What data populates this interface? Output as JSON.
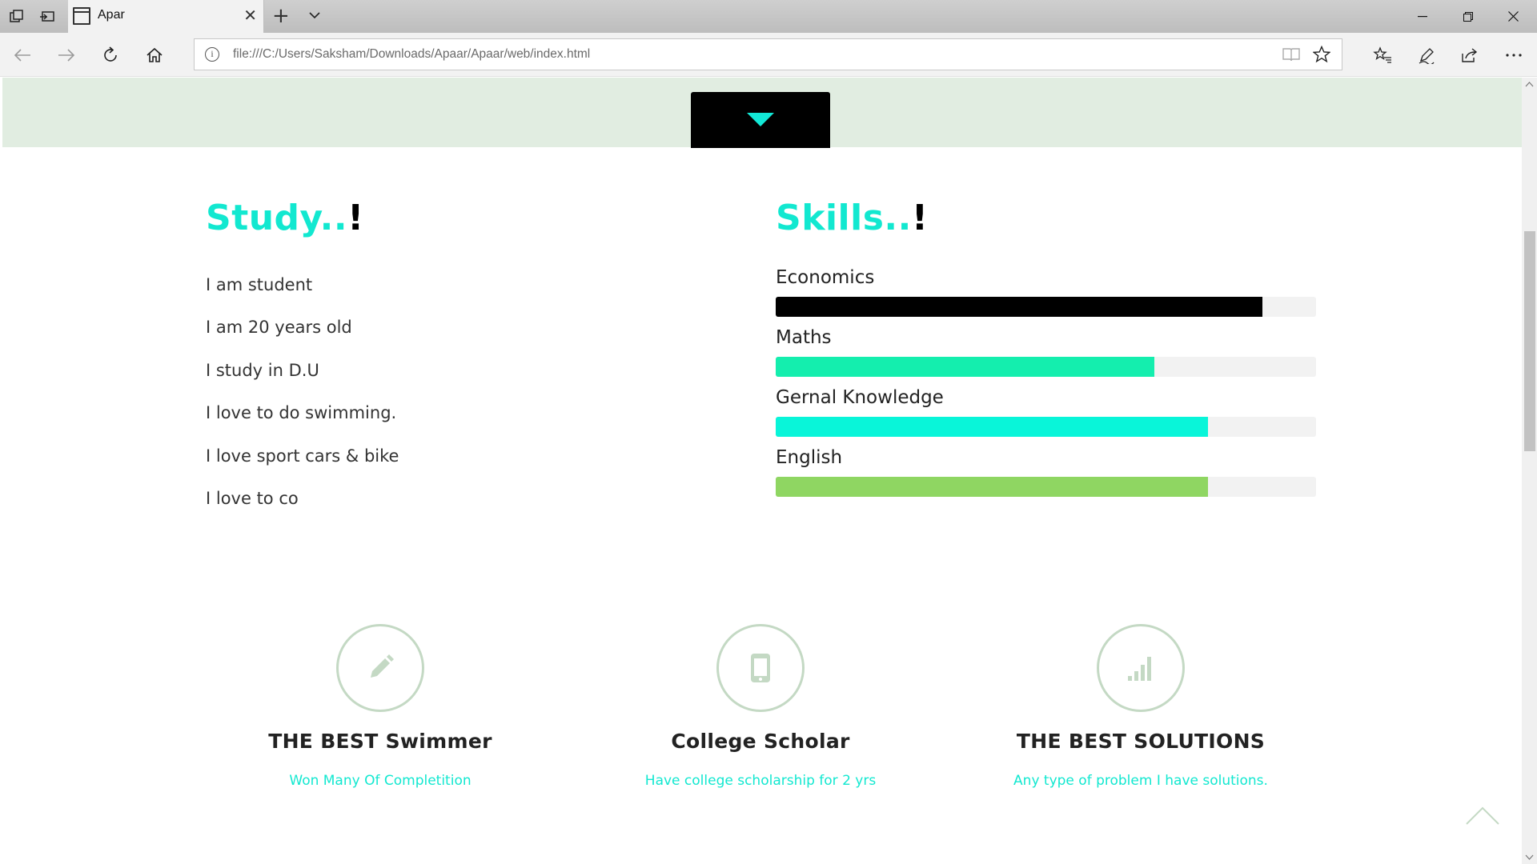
{
  "browser": {
    "tab_title": "Apar",
    "address": "file:///C:/Users/Saksham/Downloads/Apaar/Apaar/web/index.html"
  },
  "study": {
    "title_main": "Study..",
    "title_bang": "!",
    "items": [
      "I am student",
      "I am 20 years old",
      "I study in D.U",
      "I love to do swimming.",
      "I love sport cars & bike",
      "I love to co"
    ]
  },
  "skills": {
    "title_main": "Skills..",
    "title_bang": "!",
    "items": [
      {
        "label": "Economics",
        "percent": 90,
        "color": "#000000"
      },
      {
        "label": "Maths",
        "percent": 70,
        "color": "#14eeae"
      },
      {
        "label": "Gernal Knowledge",
        "percent": 80,
        "color": "#09f5d9"
      },
      {
        "label": "English",
        "percent": 80,
        "color": "#8fd662"
      }
    ]
  },
  "features": [
    {
      "icon": "pencil-icon",
      "title": "THE BEST Swimmer",
      "desc": "Won Many Of Completition"
    },
    {
      "icon": "phone-icon",
      "title": "College Scholar",
      "desc": "Have college scholarship for 2 yrs"
    },
    {
      "icon": "signal-icon",
      "title": "THE BEST SOLUTIONS",
      "desc": "Any type of problem I have solutions."
    }
  ],
  "colors": {
    "accent": "#12e8d0",
    "band": "#e1ede1",
    "icon_circle": "#c4d9c4"
  }
}
